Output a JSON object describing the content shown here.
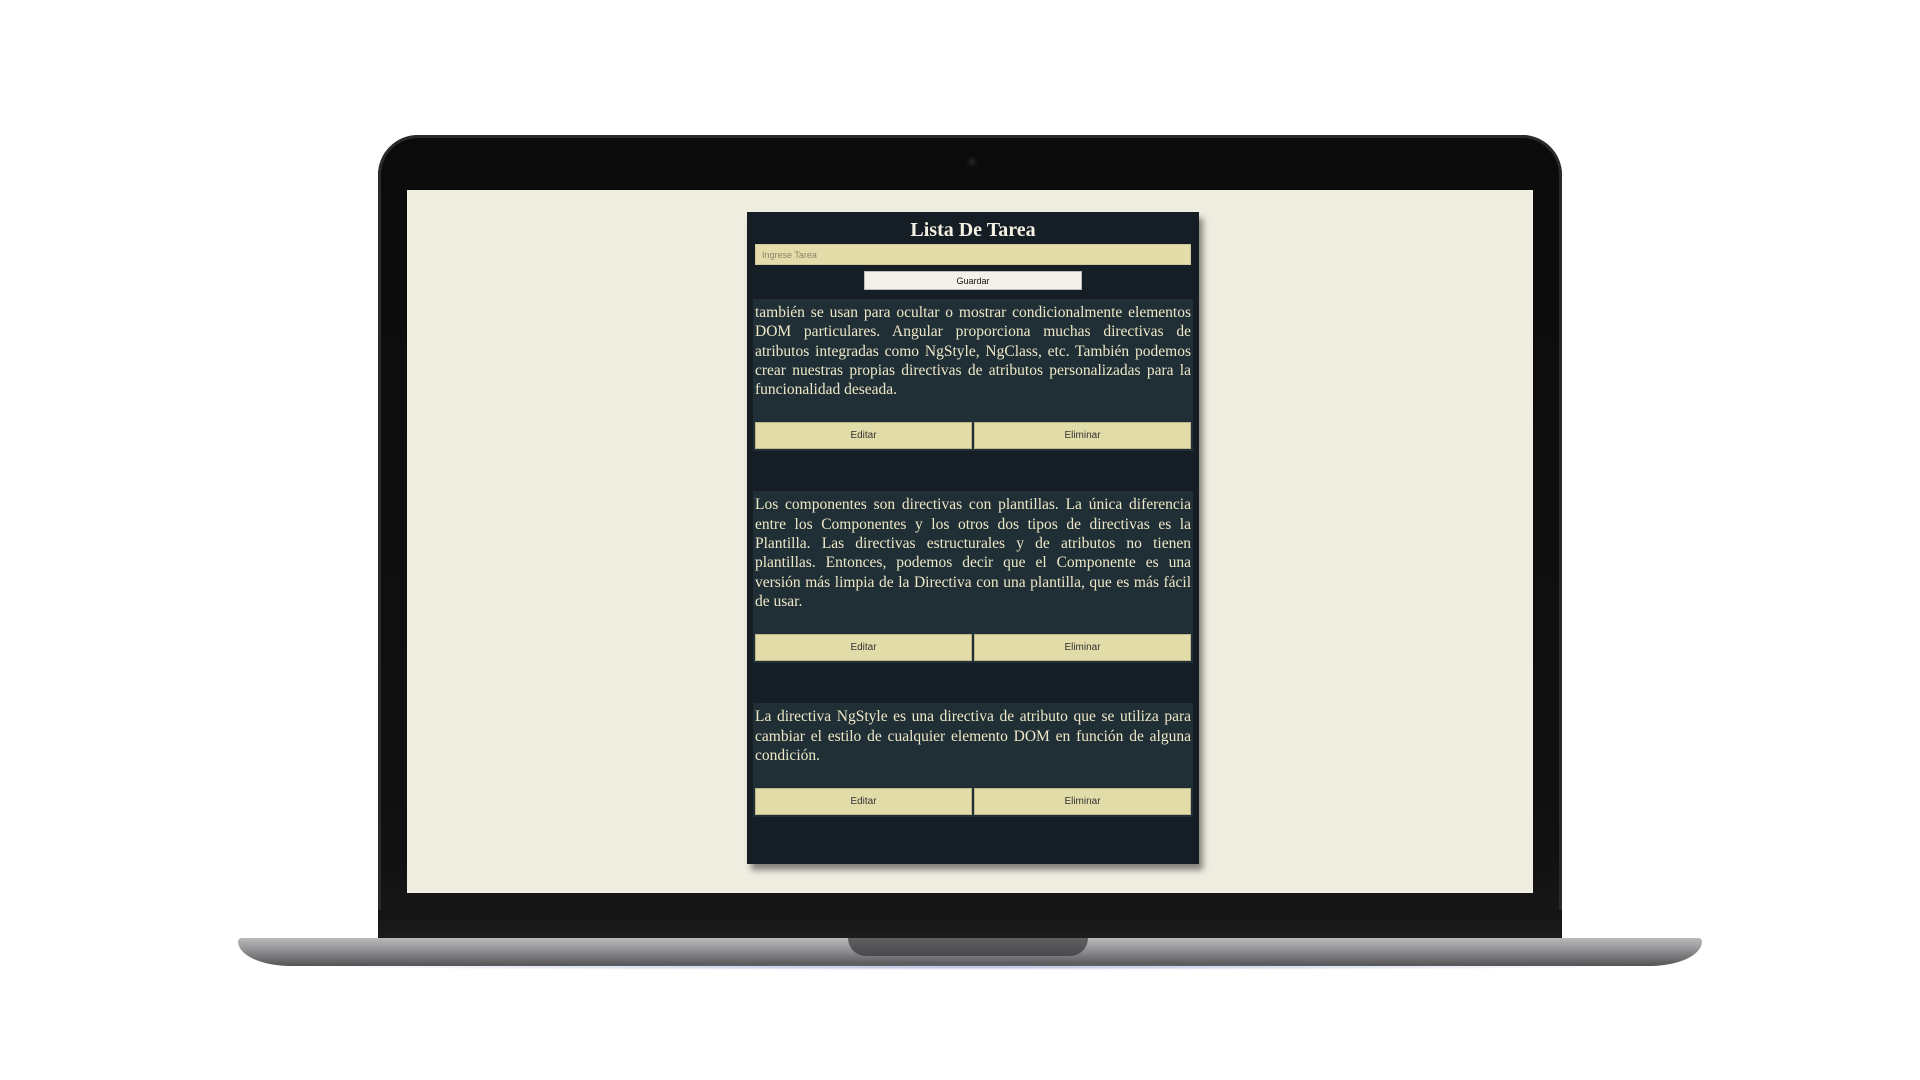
{
  "app": {
    "title": "Lista De Tarea",
    "input": {
      "placeholder": "Ingrese Tarea",
      "value": ""
    },
    "save_label": "Guardar",
    "edit_label": "Editar",
    "delete_label": "Eliminar",
    "tasks": [
      {
        "text": "también se usan para ocultar o mostrar condicionalmente elementos DOM particulares. Angular proporciona muchas directivas de atributos integradas como NgStyle, NgClass, etc. También podemos crear nuestras propias directivas de atributos personalizadas para la funcionalidad deseada."
      },
      {
        "text": "Los componentes son directivas con plantillas. La única diferencia entre los Componentes y los otros dos tipos de directivas es la Plantilla. Las directivas estructurales y de atributos no tienen plantillas. Entonces, podemos decir que el Componente es una versión más limpia de la Directiva con una plantilla, que es más fácil de usar."
      },
      {
        "text": "La directiva NgStyle es una directiva de atributo que se utiliza para cambiar el estilo de cualquier elemento DOM en función de alguna condición."
      }
    ]
  },
  "colors": {
    "screen_background": "#efede0",
    "card_background": "#141e24",
    "task_background": "#1f2f35",
    "button_background": "#e2dca8",
    "task_text": "#efe8c8"
  }
}
